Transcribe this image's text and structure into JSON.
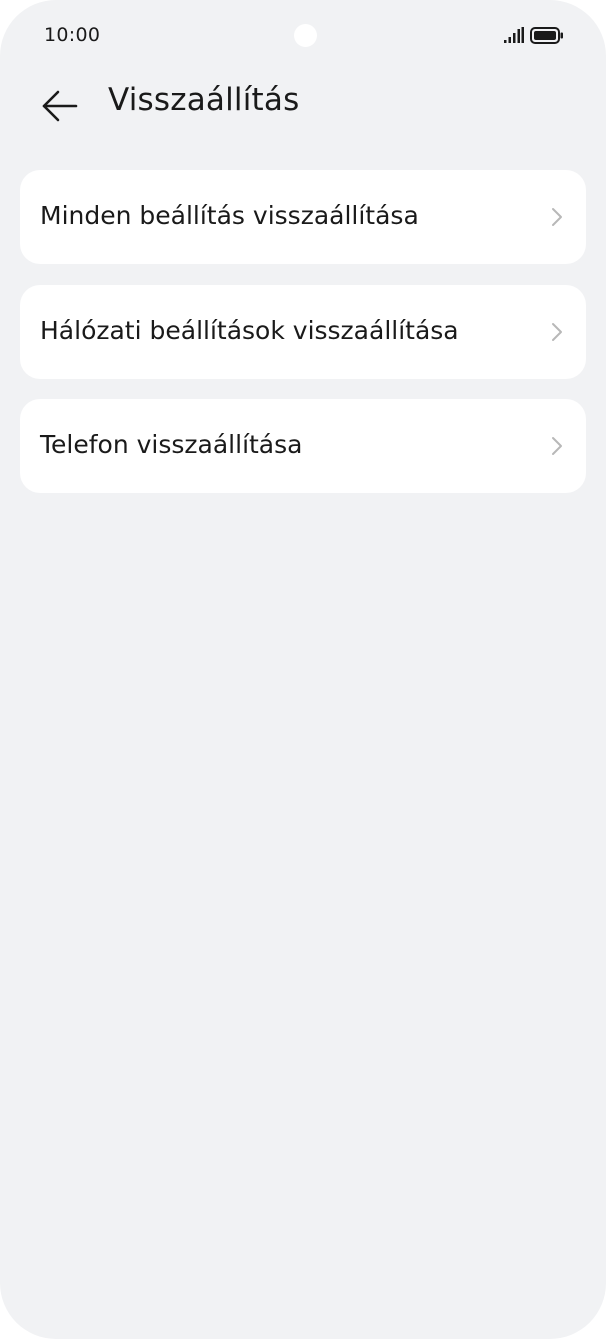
{
  "status_bar": {
    "time": "10:00",
    "icons": [
      "signal-icon",
      "battery-icon"
    ]
  },
  "header": {
    "back_icon": "arrow-left-icon",
    "title": "Visszaállítás"
  },
  "reset_options": [
    {
      "label": "Minden beállítás visszaállítása",
      "icon": "chevron-right-icon"
    },
    {
      "label": "Hálózati beállítások visszaállítása",
      "icon": "chevron-right-icon"
    },
    {
      "label": "Telefon visszaállítása",
      "icon": "chevron-right-icon"
    }
  ],
  "colors": {
    "background": "#f1f2f4",
    "card": "#ffffff",
    "text": "#1a1a1a",
    "chevron": "#b8b8b8"
  }
}
